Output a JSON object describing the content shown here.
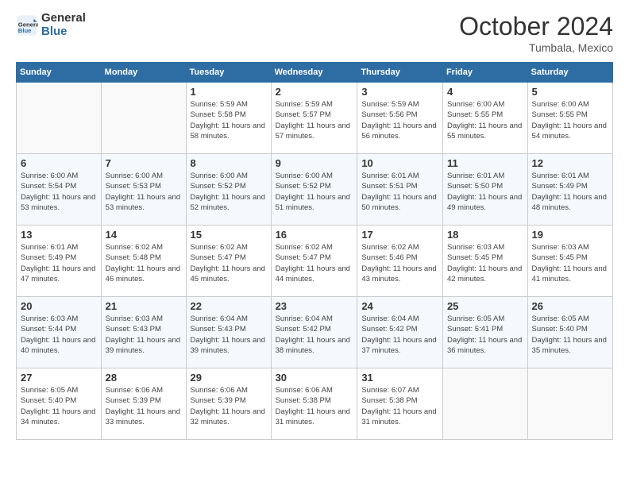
{
  "logo": {
    "line1": "General",
    "line2": "Blue"
  },
  "title": "October 2024",
  "subtitle": "Tumbala, Mexico",
  "days_of_week": [
    "Sunday",
    "Monday",
    "Tuesday",
    "Wednesday",
    "Thursday",
    "Friday",
    "Saturday"
  ],
  "weeks": [
    [
      {
        "day": "",
        "info": ""
      },
      {
        "day": "",
        "info": ""
      },
      {
        "day": "1",
        "info": "Sunrise: 5:59 AM\nSunset: 5:58 PM\nDaylight: 11 hours and 58 minutes."
      },
      {
        "day": "2",
        "info": "Sunrise: 5:59 AM\nSunset: 5:57 PM\nDaylight: 11 hours and 57 minutes."
      },
      {
        "day": "3",
        "info": "Sunrise: 5:59 AM\nSunset: 5:56 PM\nDaylight: 11 hours and 56 minutes."
      },
      {
        "day": "4",
        "info": "Sunrise: 6:00 AM\nSunset: 5:55 PM\nDaylight: 11 hours and 55 minutes."
      },
      {
        "day": "5",
        "info": "Sunrise: 6:00 AM\nSunset: 5:55 PM\nDaylight: 11 hours and 54 minutes."
      }
    ],
    [
      {
        "day": "6",
        "info": "Sunrise: 6:00 AM\nSunset: 5:54 PM\nDaylight: 11 hours and 53 minutes."
      },
      {
        "day": "7",
        "info": "Sunrise: 6:00 AM\nSunset: 5:53 PM\nDaylight: 11 hours and 53 minutes."
      },
      {
        "day": "8",
        "info": "Sunrise: 6:00 AM\nSunset: 5:52 PM\nDaylight: 11 hours and 52 minutes."
      },
      {
        "day": "9",
        "info": "Sunrise: 6:00 AM\nSunset: 5:52 PM\nDaylight: 11 hours and 51 minutes."
      },
      {
        "day": "10",
        "info": "Sunrise: 6:01 AM\nSunset: 5:51 PM\nDaylight: 11 hours and 50 minutes."
      },
      {
        "day": "11",
        "info": "Sunrise: 6:01 AM\nSunset: 5:50 PM\nDaylight: 11 hours and 49 minutes."
      },
      {
        "day": "12",
        "info": "Sunrise: 6:01 AM\nSunset: 5:49 PM\nDaylight: 11 hours and 48 minutes."
      }
    ],
    [
      {
        "day": "13",
        "info": "Sunrise: 6:01 AM\nSunset: 5:49 PM\nDaylight: 11 hours and 47 minutes."
      },
      {
        "day": "14",
        "info": "Sunrise: 6:02 AM\nSunset: 5:48 PM\nDaylight: 11 hours and 46 minutes."
      },
      {
        "day": "15",
        "info": "Sunrise: 6:02 AM\nSunset: 5:47 PM\nDaylight: 11 hours and 45 minutes."
      },
      {
        "day": "16",
        "info": "Sunrise: 6:02 AM\nSunset: 5:47 PM\nDaylight: 11 hours and 44 minutes."
      },
      {
        "day": "17",
        "info": "Sunrise: 6:02 AM\nSunset: 5:46 PM\nDaylight: 11 hours and 43 minutes."
      },
      {
        "day": "18",
        "info": "Sunrise: 6:03 AM\nSunset: 5:45 PM\nDaylight: 11 hours and 42 minutes."
      },
      {
        "day": "19",
        "info": "Sunrise: 6:03 AM\nSunset: 5:45 PM\nDaylight: 11 hours and 41 minutes."
      }
    ],
    [
      {
        "day": "20",
        "info": "Sunrise: 6:03 AM\nSunset: 5:44 PM\nDaylight: 11 hours and 40 minutes."
      },
      {
        "day": "21",
        "info": "Sunrise: 6:03 AM\nSunset: 5:43 PM\nDaylight: 11 hours and 39 minutes."
      },
      {
        "day": "22",
        "info": "Sunrise: 6:04 AM\nSunset: 5:43 PM\nDaylight: 11 hours and 39 minutes."
      },
      {
        "day": "23",
        "info": "Sunrise: 6:04 AM\nSunset: 5:42 PM\nDaylight: 11 hours and 38 minutes."
      },
      {
        "day": "24",
        "info": "Sunrise: 6:04 AM\nSunset: 5:42 PM\nDaylight: 11 hours and 37 minutes."
      },
      {
        "day": "25",
        "info": "Sunrise: 6:05 AM\nSunset: 5:41 PM\nDaylight: 11 hours and 36 minutes."
      },
      {
        "day": "26",
        "info": "Sunrise: 6:05 AM\nSunset: 5:40 PM\nDaylight: 11 hours and 35 minutes."
      }
    ],
    [
      {
        "day": "27",
        "info": "Sunrise: 6:05 AM\nSunset: 5:40 PM\nDaylight: 11 hours and 34 minutes."
      },
      {
        "day": "28",
        "info": "Sunrise: 6:06 AM\nSunset: 5:39 PM\nDaylight: 11 hours and 33 minutes."
      },
      {
        "day": "29",
        "info": "Sunrise: 6:06 AM\nSunset: 5:39 PM\nDaylight: 11 hours and 32 minutes."
      },
      {
        "day": "30",
        "info": "Sunrise: 6:06 AM\nSunset: 5:38 PM\nDaylight: 11 hours and 31 minutes."
      },
      {
        "day": "31",
        "info": "Sunrise: 6:07 AM\nSunset: 5:38 PM\nDaylight: 11 hours and 31 minutes."
      },
      {
        "day": "",
        "info": ""
      },
      {
        "day": "",
        "info": ""
      }
    ]
  ]
}
